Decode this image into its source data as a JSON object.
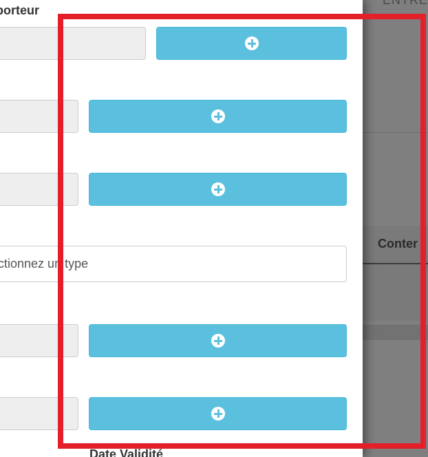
{
  "backdrop": {
    "top_text": "ENTRE",
    "tab_label": "Conter"
  },
  "modal": {
    "top_label": "porteur",
    "bottom_label": "Date Validité",
    "type_select": {
      "value": "ectionnez un type"
    },
    "add_button_icon": "plus-circle-icon"
  },
  "colors": {
    "button_bg": "#5bc0de",
    "field_bg": "#eeeeee",
    "annotation": "#e3202a"
  }
}
